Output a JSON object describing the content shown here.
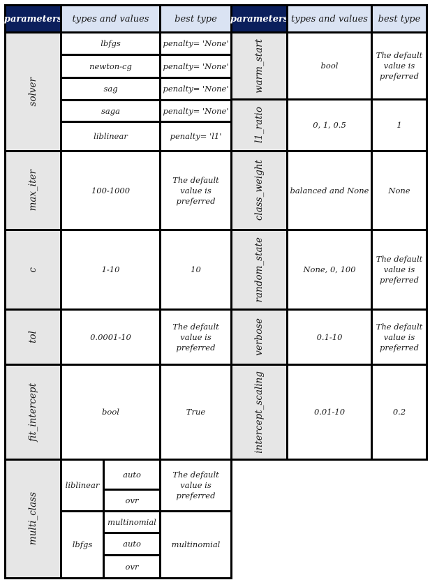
{
  "headers": {
    "left": {
      "parameters": "parameters",
      "types": "types and values",
      "best": "best type"
    },
    "right": {
      "parameters": "parameters",
      "types": "types and values",
      "best": "best type"
    }
  },
  "left_table": {
    "solver": {
      "name": "solver",
      "rows": [
        {
          "value": "lbfgs",
          "best": "penalty= 'None'"
        },
        {
          "value": "newton-cg",
          "best": "penalty= 'None'"
        },
        {
          "value": "sag",
          "best": "penalty= 'None'"
        },
        {
          "value": "saga",
          "best": "penalty= 'None'"
        },
        {
          "value": "liblinear",
          "best": "penalty= 'l1'"
        }
      ]
    },
    "max_iter": {
      "name": "max_iter",
      "value": "100-1000",
      "best": "The default value is preferred"
    },
    "c": {
      "name": "c",
      "value": "1-10",
      "best": "10"
    },
    "tol": {
      "name": "tol",
      "value": "0.0001-10",
      "best": "The default value is preferred"
    },
    "fit_intercept": {
      "name": "fit_intercept",
      "value": "bool",
      "best": "True"
    },
    "multi_class": {
      "name": "multi_class",
      "groups": [
        {
          "solver": "liblinear",
          "options": [
            "auto",
            "ovr"
          ],
          "best": "The default value is preferred"
        },
        {
          "solver": "lbfgs",
          "options": [
            "multinomial",
            "auto",
            "ovr"
          ],
          "best": "multinomial"
        }
      ]
    }
  },
  "right_table": {
    "warm_start": {
      "name": "warm_start",
      "value": "bool",
      "best": "The default value is preferred"
    },
    "l1_ratio": {
      "name": "l1_ratio",
      "value": "0, 1, 0.5",
      "best": "1"
    },
    "class_weight": {
      "name": "class_weight",
      "value": "balanced and None",
      "best": "None"
    },
    "random_state": {
      "name": "random_state",
      "value": "None, 0, 100",
      "best": "The default value is preferred"
    },
    "verbose": {
      "name": "verbose",
      "value": "0.1-10",
      "best": "The default value is preferred"
    },
    "intercept_scaling": {
      "name": "intercept_scaling",
      "value": "0.01-10",
      "best": "0.2"
    }
  }
}
